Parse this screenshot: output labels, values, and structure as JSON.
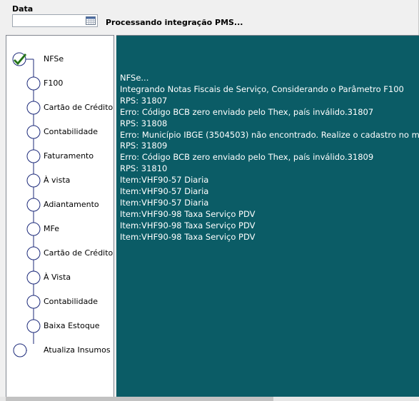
{
  "header": {
    "date_label": "Data",
    "date_value": "",
    "status": "Processando integração PMS..."
  },
  "steps": [
    {
      "label": "NFSe",
      "state": "done"
    },
    {
      "label": "F100",
      "state": "pending"
    },
    {
      "label": "Cartão de Crédito",
      "state": "pending"
    },
    {
      "label": "Contabilidade",
      "state": "pending"
    },
    {
      "label": "Faturamento",
      "state": "pending"
    },
    {
      "label": "À vista",
      "state": "pending"
    },
    {
      "label": "Adiantamento",
      "state": "pending"
    },
    {
      "label": "MFe",
      "state": "pending"
    },
    {
      "label": "Cartão de Crédito",
      "state": "pending"
    },
    {
      "label": "À Vista",
      "state": "pending"
    },
    {
      "label": "Contabilidade",
      "state": "pending"
    },
    {
      "label": "Baixa Estoque",
      "state": "pending"
    },
    {
      "label": "Atualiza Insumos",
      "state": "pending"
    }
  ],
  "log": [
    "NFSe...",
    "Integrando Notas Fiscais de Serviço, Considerando o Parâmetro F100",
    "RPS: 31807",
    "Erro: Código BCB zero enviado pelo Thex, país inválido.31807",
    "RPS: 31808",
    "Erro: Município IBGE (3504503) não encontrado. Realize o cadastro no m",
    "RPS: 31809",
    "Erro: Código BCB zero enviado pelo Thex, país inválido.31809",
    "RPS: 31810",
    "Item:VHF90-57 Diaria",
    "Item:VHF90-57 Diaria",
    "Item:VHF90-57 Diaria",
    "Item:VHF90-98 Taxa Serviço PDV",
    "Item:VHF90-98 Taxa Serviço PDV",
    "Item:VHF90-98 Taxa Serviço PDV"
  ],
  "colors": {
    "log_background": "#0b5c66",
    "log_text": "#ffffff",
    "step_line": "#1c2a7a",
    "done_check": "#3a9a2a"
  },
  "icons": {
    "date_picker": "calendar-icon",
    "done_step": "checkmark-icon",
    "pending_step": "circle-icon"
  }
}
